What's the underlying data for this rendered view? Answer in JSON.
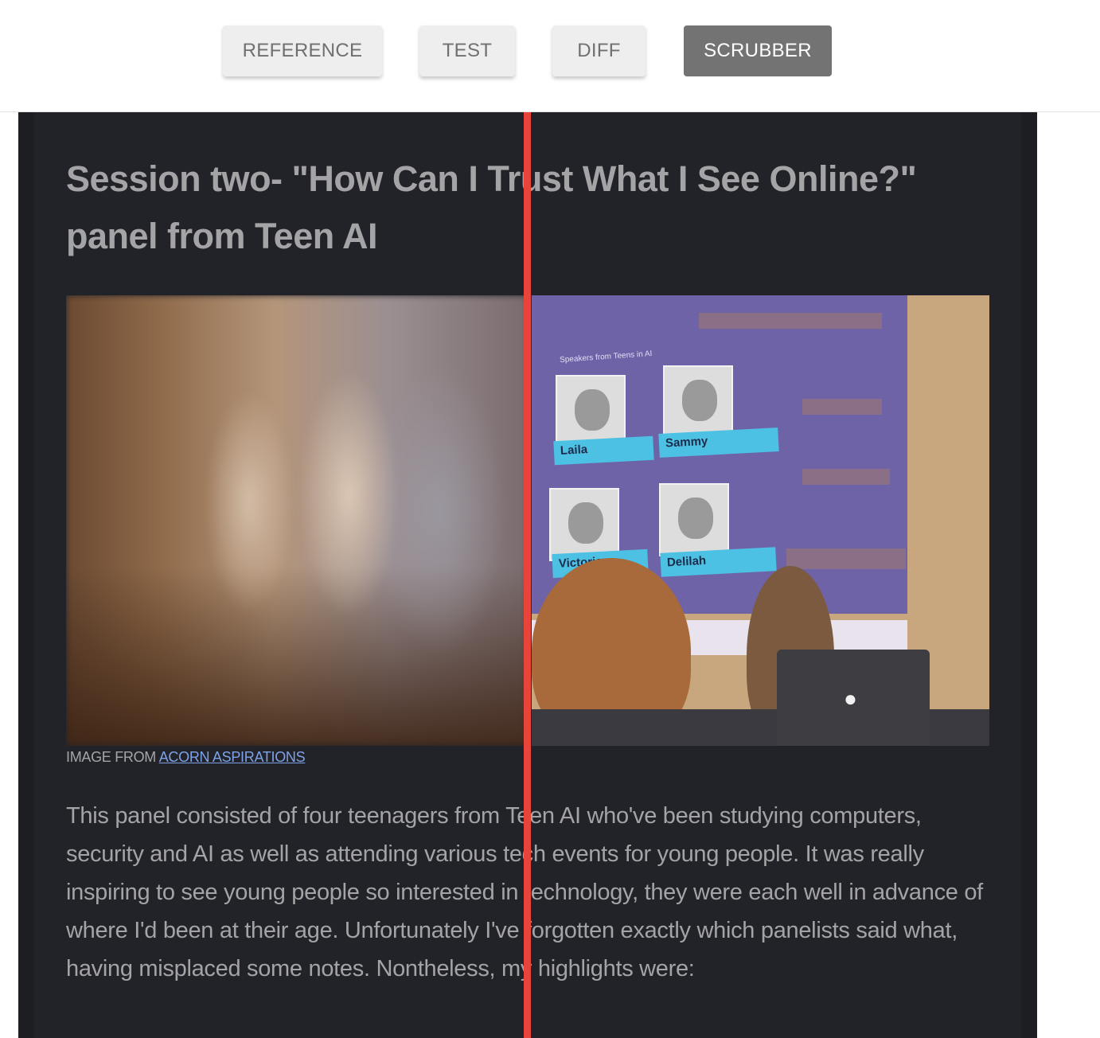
{
  "toolbar": {
    "buttons": [
      {
        "label": "REFERENCE",
        "active": false
      },
      {
        "label": "TEST",
        "active": false
      },
      {
        "label": "DIFF",
        "active": false
      },
      {
        "label": "SCRUBBER",
        "active": true
      }
    ]
  },
  "article": {
    "title": "Session two- \"How Can I Trust What I See Online?\" panel from Teen AI",
    "image": {
      "slide_heading": "Speakers from Teens in AI",
      "speakers": [
        "Laila",
        "Sammy",
        "Victoria",
        "Delilah"
      ],
      "caption_prefix": "IMAGE FROM",
      "caption_link": "ACORN ASPIRATIONS"
    },
    "body": "This panel consisted of four teenagers from Teen AI who've been studying computers, security and AI as well as attending various tech events for young people. It was really inspiring to see young people so interested in technology, they were each well in advance of where I'd been at their age. Unfortunately I've forgotten exactly which panelists said what, having misplaced some notes. Nontheless, my highlights were:"
  },
  "colors": {
    "scrubber_line": "#e8443a",
    "active_button": "#737373",
    "page_background": "#1d1e22"
  }
}
